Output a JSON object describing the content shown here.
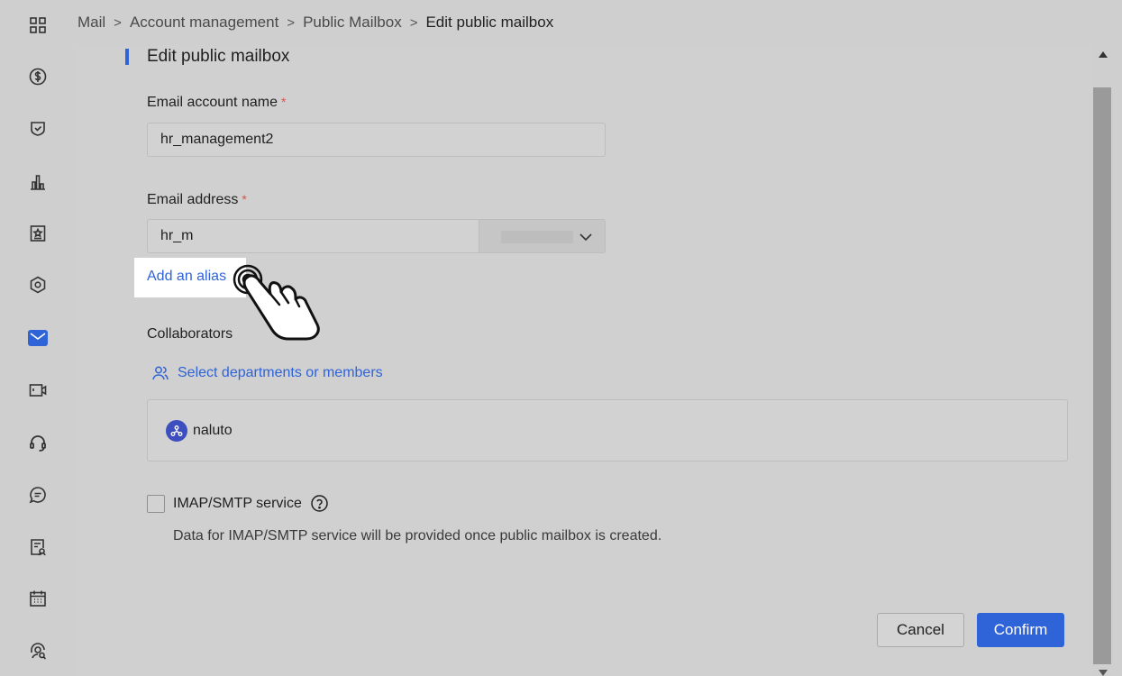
{
  "breadcrumb": {
    "items": [
      "Mail",
      "Account management",
      "Public Mailbox",
      "Edit public mailbox"
    ],
    "separator": ">"
  },
  "rail": {
    "icons": [
      "grid-icon",
      "dollar-icon",
      "shield-check-icon",
      "bar-chart-icon",
      "star-doc-icon",
      "hexagon-icon",
      "mail-icon",
      "video-icon",
      "headset-icon",
      "chat-icon",
      "report-icon",
      "calendar-icon",
      "user-search-icon"
    ],
    "active": "mail-icon"
  },
  "form": {
    "section_title": "Edit public mailbox",
    "account_name_label": "Email account name",
    "required_mark": "*",
    "account_name_value": "hr_management2",
    "email_label": "Email address",
    "email_prefix_value": "hr_m",
    "add_alias_label": "Add an alias",
    "collaborators_label": "Collaborators",
    "select_members_label": "Select departments or members",
    "members": [
      {
        "name": "naluto"
      }
    ],
    "imap_label": "IMAP/SMTP service",
    "imap_desc": "Data for IMAP/SMTP service will be provided once public mailbox is created.",
    "imap_checked": false
  },
  "buttons": {
    "cancel": "Cancel",
    "confirm": "Confirm"
  },
  "colors": {
    "accent": "#2f63d8",
    "required": "#d9534f"
  }
}
